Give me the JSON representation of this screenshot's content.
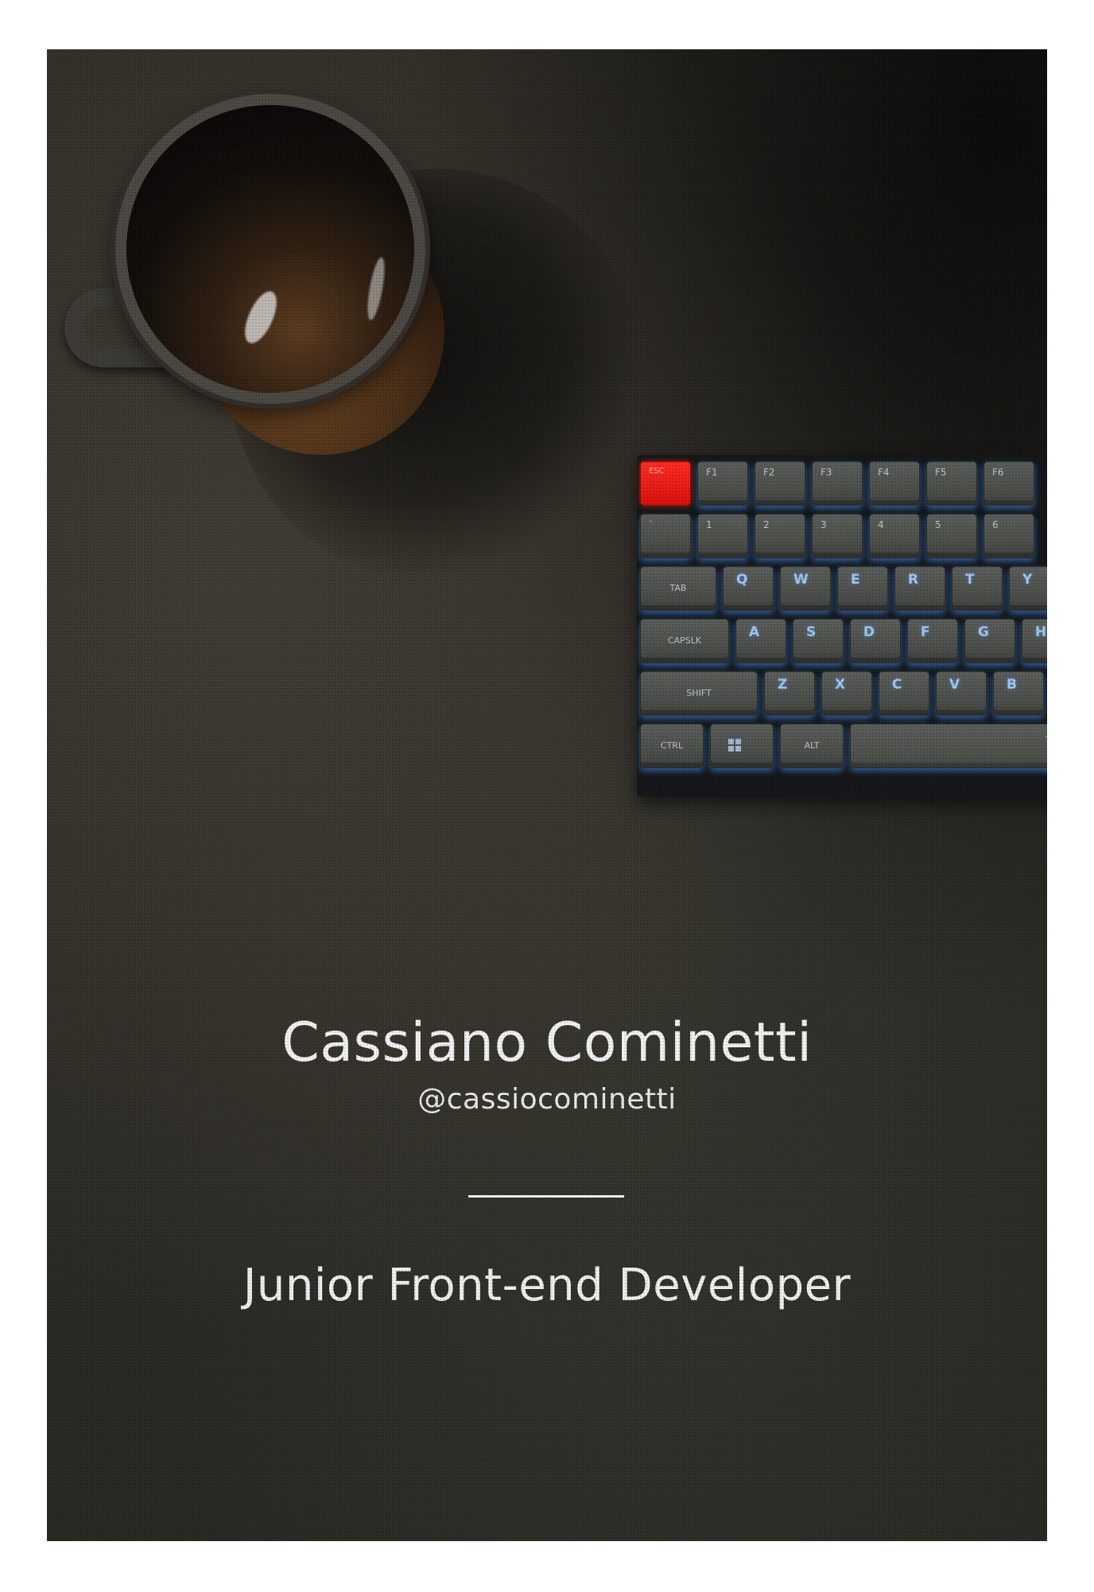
{
  "profile": {
    "name": "Cassiano Cominetti",
    "handle": "@cassiocominetti",
    "role": "Junior Front-end Developer"
  },
  "keyboard": {
    "row_function": [
      "ESC",
      "F1",
      "F2",
      "F3",
      "F4",
      "F5",
      "F6"
    ],
    "row_numbers": [
      "`",
      "1",
      "2",
      "3",
      "4",
      "5",
      "6"
    ],
    "row_top": [
      "TAB",
      "Q",
      "W",
      "E",
      "R",
      "T",
      "Y"
    ],
    "row_home": [
      "CAPSLK",
      "A",
      "S",
      "D",
      "F",
      "G",
      "H"
    ],
    "row_bottom": [
      "SHIFT",
      "Z",
      "X",
      "C",
      "V",
      "B"
    ],
    "row_space": [
      "CTRL",
      "",
      "ALT",
      "—"
    ]
  },
  "colors": {
    "background": "#2a2924",
    "text": "#f2f2f2",
    "esc_key": "#e0150f",
    "key_glow": "#4696ff"
  },
  "icons": {
    "windows_key": "windows-icon"
  }
}
